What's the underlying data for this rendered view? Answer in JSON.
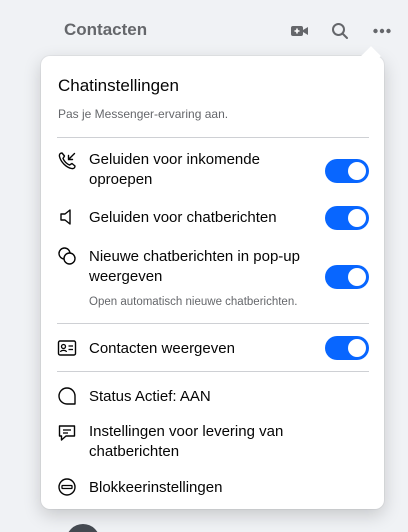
{
  "header": {
    "title": "Contacten",
    "icons": [
      "new-room-icon",
      "search-icon",
      "more-options-icon"
    ]
  },
  "menu": {
    "title": "Chatinstellingen",
    "subtitle": "Pas je Messenger-ervaring aan.",
    "items": [
      {
        "icon": "phone-incoming-icon",
        "label": "Geluiden voor inkomende oproepen",
        "toggle": true
      },
      {
        "icon": "speaker-icon",
        "label": "Geluiden voor chatberichten",
        "toggle": true
      },
      {
        "icon": "chat-bubbles-icon",
        "label": "Nieuwe chatberichten in pop-up weergeven",
        "hint": "Open automatisch nieuwe chatberichten.",
        "toggle": true
      },
      {
        "icon": "contacts-card-icon",
        "label": "Contacten weergeven",
        "toggle": true
      },
      {
        "icon": "active-status-icon",
        "label": "Status Actief: AAN"
      },
      {
        "icon": "message-delivery-icon",
        "label": "Instellingen voor levering van chatberichten"
      },
      {
        "icon": "block-icon",
        "label": "Blokkeerinstellingen"
      }
    ]
  },
  "colors": {
    "accent": "#0866ff",
    "text_primary": "#050505",
    "text_secondary": "#65676b",
    "background": "#f0f2f5"
  }
}
